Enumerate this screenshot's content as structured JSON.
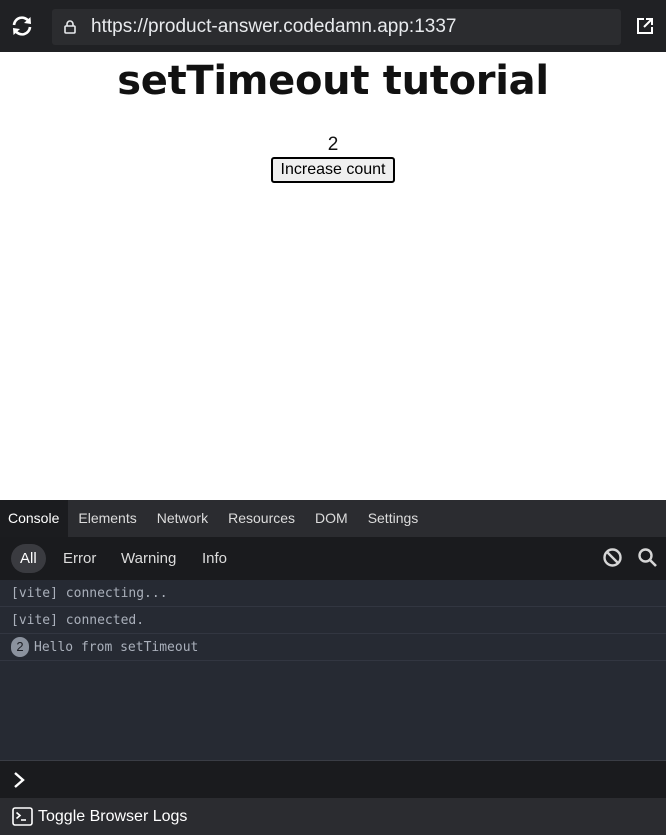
{
  "browser": {
    "url": "https://product-answer.codedamn.app:1337",
    "icons": {
      "reload": "reload-icon",
      "lock": "lock-icon",
      "open_external": "open-external-icon"
    }
  },
  "page": {
    "title": "setTimeout tutorial",
    "count": "2",
    "button_label": "Increase count"
  },
  "devtools": {
    "tabs": [
      {
        "label": "Console",
        "active": true
      },
      {
        "label": "Elements",
        "active": false
      },
      {
        "label": "Network",
        "active": false
      },
      {
        "label": "Resources",
        "active": false
      },
      {
        "label": "DOM",
        "active": false
      },
      {
        "label": "Settings",
        "active": false
      }
    ],
    "filters": [
      {
        "label": "All",
        "active": true
      },
      {
        "label": "Error",
        "active": false
      },
      {
        "label": "Warning",
        "active": false
      },
      {
        "label": "Info",
        "active": false
      }
    ],
    "logs": [
      {
        "text": "[vite] connecting...",
        "count": ""
      },
      {
        "text": "[vite] connected.",
        "count": ""
      },
      {
        "text": "Hello from setTimeout",
        "count": "2"
      }
    ],
    "toggle_label": "Toggle Browser Logs"
  },
  "colors": {
    "topbar_bg": "#202124",
    "devtools_bg": "#2b2c30",
    "log_bg": "#262a33"
  }
}
